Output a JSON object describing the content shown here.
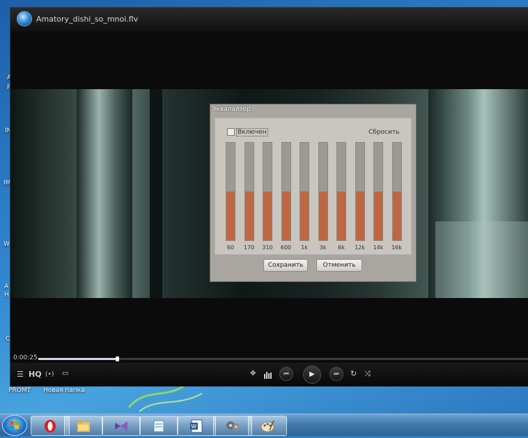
{
  "window": {
    "title": "Amatory_dishi_so_mnoi.flv"
  },
  "desktop_labels": {
    "left_a": "A",
    "left_p": "P",
    "left_in": "IN",
    "left_im": "IM",
    "left_w": "W",
    "left_ah": "A",
    "left_h": "H",
    "left_c": "C",
    "promt": "PROMT",
    "new_folder": "Новая папка"
  },
  "equalizer": {
    "title": "Эквалайзер",
    "enable_label": "Включен",
    "enabled": false,
    "reset_label": "Сбросить",
    "bands": [
      {
        "label": "60",
        "level": 0.5
      },
      {
        "label": "170",
        "level": 0.5
      },
      {
        "label": "310",
        "level": 0.5
      },
      {
        "label": "600",
        "level": 0.5
      },
      {
        "label": "1k",
        "level": 0.5
      },
      {
        "label": "3k",
        "level": 0.5
      },
      {
        "label": "6k",
        "level": 0.5
      },
      {
        "label": "12k",
        "level": 0.5
      },
      {
        "label": "14k",
        "level": 0.5
      },
      {
        "label": "16k",
        "level": 0.5
      }
    ],
    "save_label": "Сохранить",
    "cancel_label": "Отменить"
  },
  "controls": {
    "time": "0:00:25",
    "progress": 0.16,
    "hq_label": "HQ",
    "stream_label": "(•)"
  },
  "taskbar": {
    "apps": [
      "opera",
      "explorer",
      "visual-studio",
      "notepad",
      "word",
      "media-player",
      "paint"
    ]
  },
  "colors": {
    "eq_fill": "#bf6742",
    "eq_track": "#9d9a95",
    "taskbar": "#3f77ab"
  }
}
